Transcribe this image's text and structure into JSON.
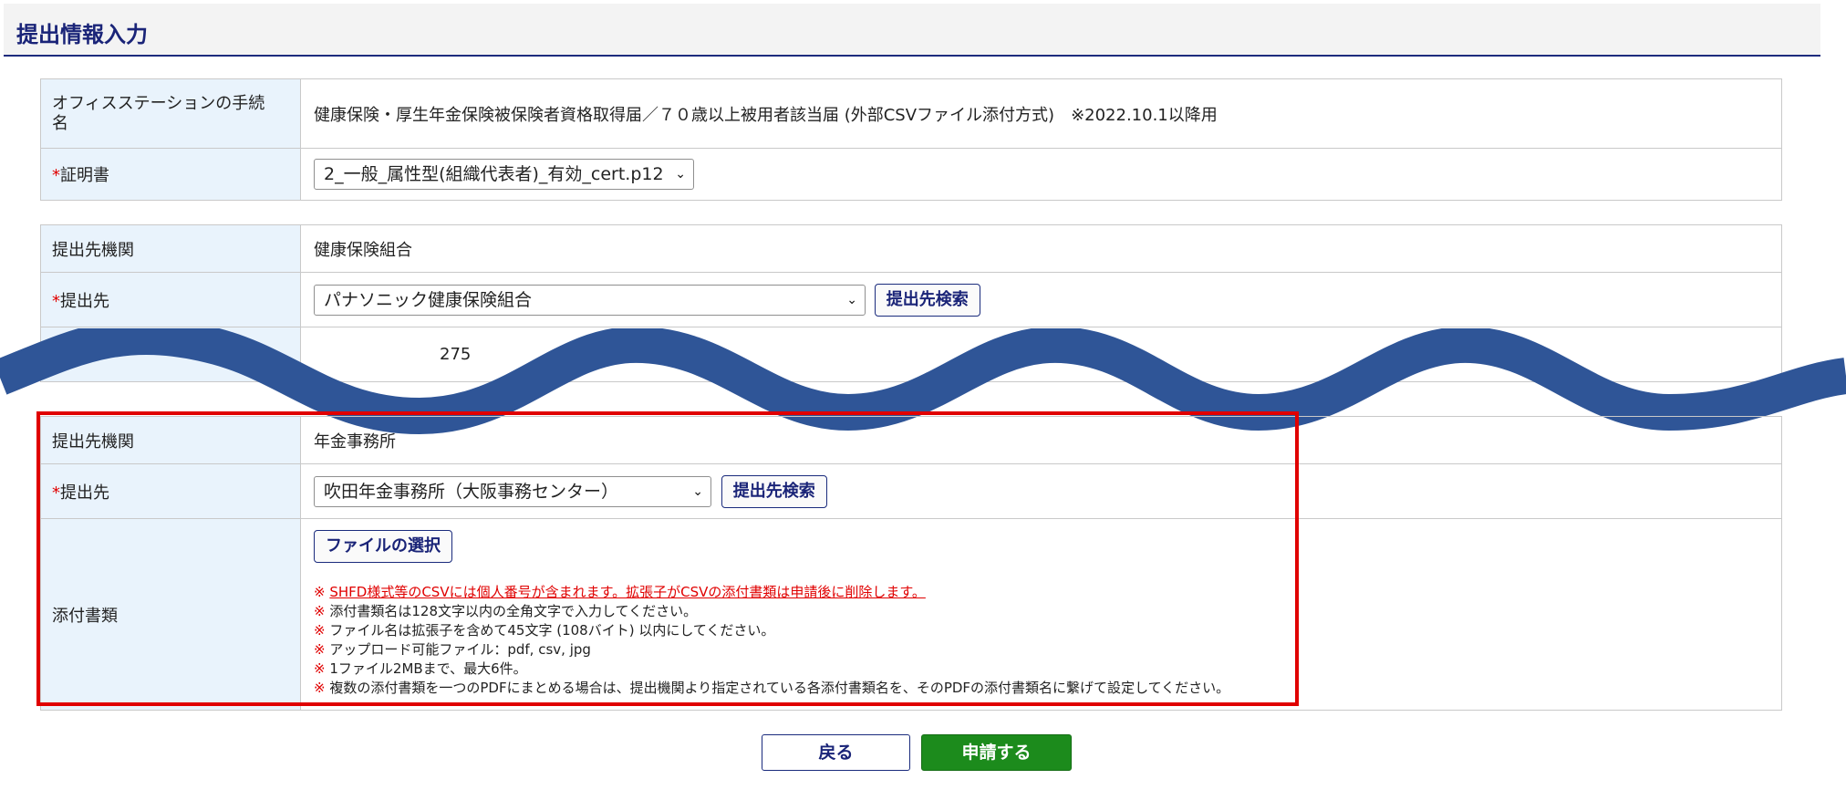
{
  "page_title": "提出情報入力",
  "section1": {
    "procedure_label": "オフィスステーションの手続名",
    "procedure_value": "健康保険・厚生年金保険被保険者資格取得届／７０歳以上被用者該当届 (外部CSVファイル添付方式)　※2022.10.1以降用",
    "required_mark": "*",
    "cert_label": "証明書",
    "cert_value": "2_一般_属性型(組織代表者)_有効_cert.p12"
  },
  "section2": {
    "org_label": "提出先機関",
    "org_value": "健康保険組合",
    "required_mark": "*",
    "dest_label": "提出先",
    "dest_value": "パナソニック健康保険組合",
    "search_button": "提出先検索",
    "partial_value": "275"
  },
  "section3": {
    "org_label": "提出先機関",
    "org_value": "年金事務所",
    "required_mark": "*",
    "dest_label": "提出先",
    "dest_value": "吹田年金事務所（大阪事務センター）",
    "search_button": "提出先検索",
    "attach_label": "添付書類",
    "file_button": "ファイルの選択",
    "note_mark": "※",
    "notes": [
      "SHFD様式等のCSVには個人番号が含まれます。拡張子がCSVの添付書類は申請後に削除します。",
      "添付書類名は128文字以内の全角文字で入力してください。",
      "ファイル名は拡張子を含めて45文字 (108バイト) 以内にしてください。",
      "アップロード可能ファイル：pdf, csv, jpg",
      "1ファイル2MBまで、最大6件。",
      "複数の添付書類を一つのPDFにまとめる場合は、提出機関より指定されている各添付書類名を、そのPDFの添付書類名に繋げて設定してください。"
    ]
  },
  "actions": {
    "back": "戻る",
    "submit": "申請する"
  },
  "colors": {
    "title": "#1a2478",
    "label_bg": "#e9f3fc",
    "highlight": "#e00000",
    "wave": "#2f5597",
    "submit_bg": "#1c8b1c"
  }
}
